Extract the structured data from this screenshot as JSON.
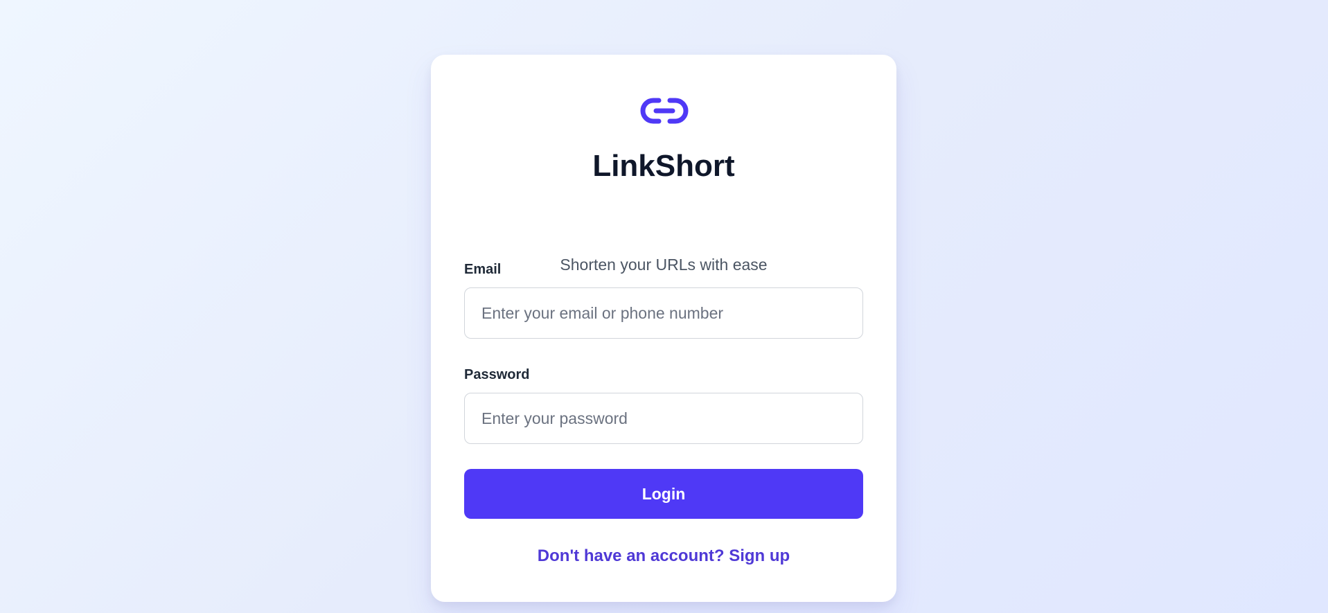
{
  "brand": {
    "logo_icon": "link-icon",
    "name": "LinkShort",
    "tagline": "Shorten your URLs with ease"
  },
  "form": {
    "email": {
      "label": "Email",
      "placeholder": "Enter your email or phone number",
      "value": ""
    },
    "password": {
      "label": "Password",
      "placeholder": "Enter your password",
      "value": ""
    },
    "submit_label": "Login",
    "signup_text": "Don't have an account? Sign up"
  },
  "colors": {
    "accent": "#4f39f6",
    "link": "#4f39d6",
    "title": "#0f172a",
    "background_start": "#eff6ff",
    "background_end": "#e0e7ff"
  }
}
